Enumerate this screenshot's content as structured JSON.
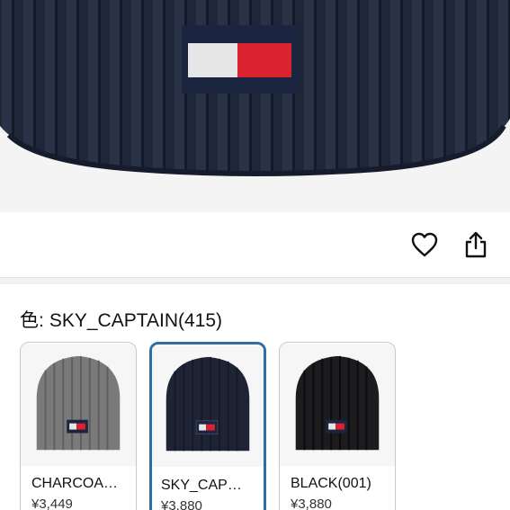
{
  "product_image": {
    "alt": "navy ribbed knit beanie with flag patch"
  },
  "actions": {
    "favorite_icon": "heart-outline-icon",
    "share_icon": "share-upload-icon"
  },
  "color": {
    "label": "色:",
    "value": "SKY_CAPTAIN(415)"
  },
  "variants": [
    {
      "name": "CHARCOA…",
      "price": "¥3,449",
      "color": "#7a7a7a",
      "selected": false
    },
    {
      "name": "SKY_CAP…",
      "price": "¥3,880",
      "color": "#1e2433",
      "selected": true
    },
    {
      "name": "BLACK(001)",
      "price": "¥3,880",
      "color": "#1c1c1e",
      "selected": false
    }
  ],
  "colors": {
    "accent": "#2f6ea5",
    "flag_white": "#e6e6e6",
    "flag_red": "#d9232e",
    "flag_navy": "#1b2540"
  }
}
